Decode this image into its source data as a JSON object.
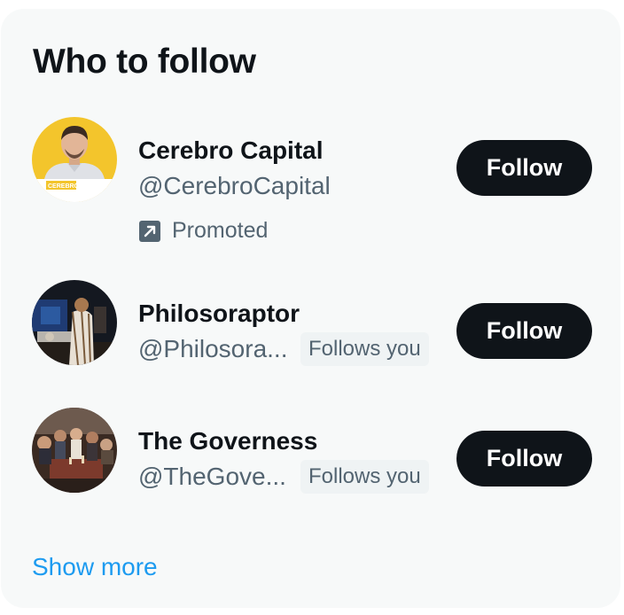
{
  "panel": {
    "title": "Who to follow",
    "show_more": "Show more"
  },
  "accounts": [
    {
      "name": "Cerebro Capital",
      "handle": "@CerebroCapital",
      "promoted_label": "Promoted",
      "follow_label": "Follow",
      "avatar_text": "CEREBRO CAPITAL"
    },
    {
      "name": "Philosoraptor",
      "handle": "@Philosora...",
      "follows_you": "Follows you",
      "follow_label": "Follow"
    },
    {
      "name": "The Governess",
      "handle": "@TheGove...",
      "follows_you": "Follows you",
      "follow_label": "Follow"
    }
  ],
  "colors": {
    "card_bg": "#f7f9f9",
    "text_primary": "#0f1419",
    "text_secondary": "#536471",
    "button_bg": "#0f1419",
    "link": "#1d9bf0",
    "badge_bg": "#eff3f4"
  }
}
